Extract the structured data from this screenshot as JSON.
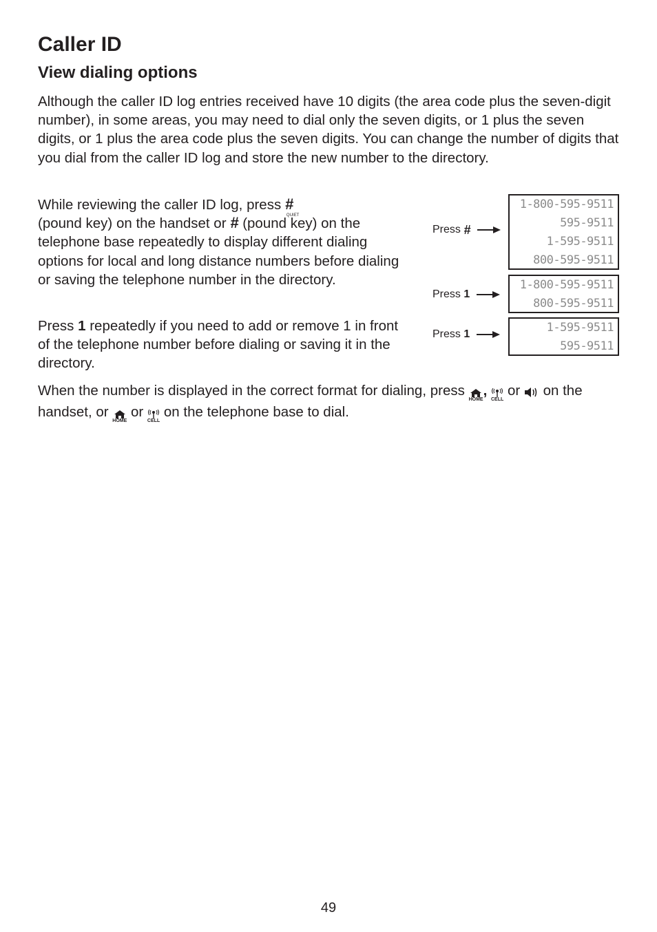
{
  "header": {
    "title": "Caller ID",
    "subtitle": "View dialing options"
  },
  "paragraphs": {
    "intro": "Although the caller ID log entries received have 10 digits (the area code plus the seven-digit number), in some areas, you may need to dial only the seven digits, or 1 plus the seven digits, or 1 plus the area code plus the seven digits. You can change the number of digits that you dial from the caller ID log and store the new number to the directory.",
    "review_a": "While reviewing the caller ID log, press",
    "review_b": "(pound key) on the handset or",
    "review_c": "(pound key) on the telephone base repeatedly to display different dialing options for local and long distance numbers before dialing or saving the telephone number in the directory.",
    "press1_a": "Press",
    "press1_key": "1",
    "press1_b": "repeatedly if you need to add or remove 1 in front of the telephone number before dialing or saving it in the directory.",
    "dial_a": "When the number is displayed in the correct format for dialing, press",
    "dial_comma": ",",
    "dial_or1": "or",
    "dial_b": "on the handset, or",
    "dial_or2": "or",
    "dial_c": "on the telephone base to dial."
  },
  "keys": {
    "pound_symbol": "#",
    "pound_sublabel": "QUIET",
    "home_label": "HOME",
    "cell_label": "CELL"
  },
  "diagram": {
    "steps": [
      {
        "press_label": "Press",
        "key": "#",
        "displays": [
          "1-800-595-9511",
          "595-9511",
          "1-595-9511",
          "800-595-9511"
        ]
      },
      {
        "press_label": "Press",
        "key": "1",
        "displays": [
          "1-800-595-9511",
          "800-595-9511"
        ]
      },
      {
        "press_label": "Press",
        "key": "1",
        "displays": [
          "1-595-9511",
          "595-9511"
        ]
      }
    ]
  },
  "footer": {
    "page_number": "49"
  }
}
